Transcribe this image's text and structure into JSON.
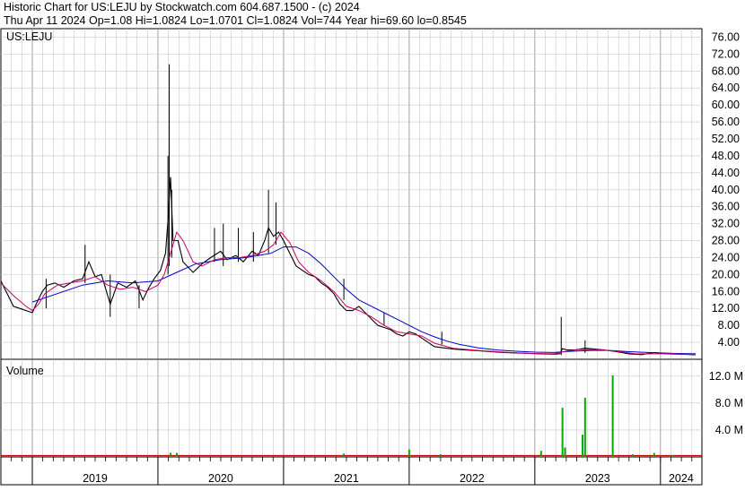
{
  "header": {
    "line1": "Historic Chart for US:LEJU by Stockwatch.com 604.687.1500 - (c) 2024",
    "line2": "Thu Apr 11 2024   Op=1.08   Hi=1.0824   Lo=1.0701   Cl=1.0824   Vol=744   Year hi=69.60   lo=0.8545"
  },
  "colors": {
    "price": "#000000",
    "ma_short": "#cc0066",
    "ma_long": "#0000cc",
    "volume": "#00aa00",
    "grid": "#c8c8c8"
  },
  "chart_data": [
    {
      "type": "line",
      "ticker_label": "US:LEJU",
      "ylim": [
        0,
        78
      ],
      "yticks": [
        "76.00",
        "72.00",
        "68.00",
        "64.00",
        "60.00",
        "56.00",
        "52.00",
        "48.00",
        "44.00",
        "40.00",
        "36.00",
        "32.00",
        "28.00",
        "24.00",
        "20.00",
        "16.00",
        "12.00",
        "8.00",
        "4.00"
      ],
      "ytick_values": [
        76,
        72,
        68,
        64,
        60,
        56,
        52,
        48,
        44,
        40,
        36,
        32,
        28,
        24,
        20,
        16,
        12,
        8,
        4
      ],
      "x_range": [
        2018.75,
        2024.33
      ],
      "grid": true,
      "price": [
        [
          2018.75,
          18.5
        ],
        [
          2018.8,
          15.5
        ],
        [
          2018.85,
          12.5
        ],
        [
          2018.9,
          12.0
        ],
        [
          2018.95,
          11.5
        ],
        [
          2019.0,
          11.0
        ],
        [
          2019.03,
          13.0
        ],
        [
          2019.08,
          16.0
        ],
        [
          2019.12,
          17.5
        ],
        [
          2019.18,
          18.0
        ],
        [
          2019.25,
          17.0
        ],
        [
          2019.33,
          18.5
        ],
        [
          2019.4,
          19.0
        ],
        [
          2019.45,
          23.0
        ],
        [
          2019.5,
          19.5
        ],
        [
          2019.55,
          20.0
        ],
        [
          2019.62,
          13.0
        ],
        [
          2019.68,
          18.0
        ],
        [
          2019.75,
          17.0
        ],
        [
          2019.82,
          18.5
        ],
        [
          2019.88,
          14.0
        ],
        [
          2019.92,
          16.5
        ],
        [
          2019.97,
          19.0
        ],
        [
          2020.02,
          21.0
        ],
        [
          2020.06,
          25.0
        ],
        [
          2020.08,
          33.0
        ],
        [
          2020.1,
          43.0
        ],
        [
          2020.12,
          28.0
        ],
        [
          2020.16,
          28.0
        ],
        [
          2020.2,
          23.0
        ],
        [
          2020.28,
          20.5
        ],
        [
          2020.35,
          22.5
        ],
        [
          2020.42,
          24.0
        ],
        [
          2020.5,
          25.5
        ],
        [
          2020.55,
          23.5
        ],
        [
          2020.62,
          24.5
        ],
        [
          2020.68,
          23.0
        ],
        [
          2020.75,
          25.5
        ],
        [
          2020.8,
          24.5
        ],
        [
          2020.85,
          28.0
        ],
        [
          2020.88,
          31.0
        ],
        [
          2020.92,
          29.0
        ],
        [
          2020.96,
          30.0
        ],
        [
          2021.0,
          28.0
        ],
        [
          2021.05,
          25.0
        ],
        [
          2021.1,
          22.0
        ],
        [
          2021.15,
          21.0
        ],
        [
          2021.2,
          20.0
        ],
        [
          2021.25,
          19.5
        ],
        [
          2021.3,
          18.0
        ],
        [
          2021.35,
          17.0
        ],
        [
          2021.4,
          15.5
        ],
        [
          2021.45,
          13.0
        ],
        [
          2021.5,
          11.5
        ],
        [
          2021.55,
          11.5
        ],
        [
          2021.6,
          12.5
        ],
        [
          2021.65,
          11.0
        ],
        [
          2021.7,
          9.5
        ],
        [
          2021.75,
          8.0
        ],
        [
          2021.8,
          7.5
        ],
        [
          2021.85,
          7.0
        ],
        [
          2021.9,
          6.0
        ],
        [
          2021.95,
          5.5
        ],
        [
          2022.0,
          6.5
        ],
        [
          2022.05,
          6.0
        ],
        [
          2022.1,
          5.0
        ],
        [
          2022.15,
          4.0
        ],
        [
          2022.2,
          3.0
        ],
        [
          2022.25,
          2.8
        ],
        [
          2022.3,
          2.6
        ],
        [
          2022.35,
          2.4
        ],
        [
          2022.45,
          2.2
        ],
        [
          2022.55,
          2.0
        ],
        [
          2022.65,
          1.8
        ],
        [
          2022.75,
          1.6
        ],
        [
          2022.85,
          1.5
        ],
        [
          2022.95,
          1.4
        ],
        [
          2023.05,
          1.3
        ],
        [
          2023.15,
          1.2
        ],
        [
          2023.2,
          1.3
        ],
        [
          2023.22,
          2.5
        ],
        [
          2023.26,
          2.2
        ],
        [
          2023.32,
          2.2
        ],
        [
          2023.4,
          2.6
        ],
        [
          2023.48,
          2.4
        ],
        [
          2023.55,
          2.2
        ],
        [
          2023.65,
          1.8
        ],
        [
          2023.75,
          1.3
        ],
        [
          2023.85,
          1.1
        ],
        [
          2023.95,
          1.6
        ],
        [
          2024.05,
          1.3
        ],
        [
          2024.15,
          1.2
        ],
        [
          2024.25,
          1.1
        ],
        [
          2024.28,
          1.0824
        ]
      ],
      "spikes": [
        [
          2019.11,
          19.0,
          12.0
        ],
        [
          2019.42,
          18.0,
          27.0
        ],
        [
          2019.62,
          10.0,
          20.0
        ],
        [
          2019.85,
          12.0,
          17.5
        ],
        [
          2020.08,
          20.0,
          48.0
        ],
        [
          2020.09,
          22.0,
          69.6
        ],
        [
          2020.11,
          24.0,
          40.0
        ],
        [
          2020.45,
          23.0,
          31.0
        ],
        [
          2020.52,
          22.0,
          32.0
        ],
        [
          2020.64,
          23.0,
          31.0
        ],
        [
          2020.76,
          23.0,
          30.0
        ],
        [
          2020.88,
          25.0,
          40.0
        ],
        [
          2020.94,
          27.0,
          37.0
        ],
        [
          2021.48,
          14.0,
          19.0
        ],
        [
          2021.8,
          8.0,
          11.0
        ],
        [
          2022.26,
          3.5,
          6.5
        ],
        [
          2023.21,
          1.0,
          10.0
        ],
        [
          2023.4,
          1.5,
          4.5
        ]
      ],
      "ma_short": [
        [
          2018.75,
          18.0
        ],
        [
          2018.85,
          15.0
        ],
        [
          2018.95,
          12.5
        ],
        [
          2019.0,
          11.5
        ],
        [
          2019.05,
          13.0
        ],
        [
          2019.1,
          15.5
        ],
        [
          2019.2,
          17.5
        ],
        [
          2019.3,
          18.0
        ],
        [
          2019.4,
          18.5
        ],
        [
          2019.5,
          19.5
        ],
        [
          2019.6,
          17.5
        ],
        [
          2019.7,
          16.5
        ],
        [
          2019.8,
          17.0
        ],
        [
          2019.9,
          16.0
        ],
        [
          2020.0,
          17.5
        ],
        [
          2020.05,
          20.0
        ],
        [
          2020.1,
          25.0
        ],
        [
          2020.15,
          30.0
        ],
        [
          2020.2,
          28.0
        ],
        [
          2020.28,
          23.0
        ],
        [
          2020.35,
          22.0
        ],
        [
          2020.45,
          23.5
        ],
        [
          2020.55,
          24.0
        ],
        [
          2020.65,
          24.0
        ],
        [
          2020.75,
          24.5
        ],
        [
          2020.85,
          25.5
        ],
        [
          2020.92,
          27.0
        ],
        [
          2020.98,
          30.0
        ],
        [
          2021.05,
          27.5
        ],
        [
          2021.12,
          23.0
        ],
        [
          2021.2,
          20.5
        ],
        [
          2021.3,
          18.5
        ],
        [
          2021.4,
          16.0
        ],
        [
          2021.5,
          12.5
        ],
        [
          2021.6,
          11.5
        ],
        [
          2021.7,
          10.0
        ],
        [
          2021.8,
          8.0
        ],
        [
          2021.9,
          6.5
        ],
        [
          2022.0,
          6.0
        ],
        [
          2022.1,
          5.5
        ],
        [
          2022.2,
          3.8
        ],
        [
          2022.35,
          2.6
        ],
        [
          2022.55,
          2.1
        ],
        [
          2022.75,
          1.7
        ],
        [
          2022.95,
          1.4
        ],
        [
          2023.15,
          1.3
        ],
        [
          2023.25,
          1.9
        ],
        [
          2023.35,
          2.3
        ],
        [
          2023.5,
          2.3
        ],
        [
          2023.65,
          1.9
        ],
        [
          2023.8,
          1.3
        ],
        [
          2023.95,
          1.3
        ],
        [
          2024.1,
          1.3
        ],
        [
          2024.28,
          1.1
        ]
      ],
      "ma_long": [
        [
          2019.0,
          13.5
        ],
        [
          2019.2,
          15.5
        ],
        [
          2019.4,
          17.5
        ],
        [
          2019.6,
          18.5
        ],
        [
          2019.8,
          18.0
        ],
        [
          2020.0,
          18.5
        ],
        [
          2020.15,
          20.5
        ],
        [
          2020.3,
          22.5
        ],
        [
          2020.5,
          23.5
        ],
        [
          2020.7,
          24.0
        ],
        [
          2020.9,
          25.0
        ],
        [
          2021.0,
          26.5
        ],
        [
          2021.1,
          26.5
        ],
        [
          2021.2,
          25.0
        ],
        [
          2021.3,
          22.5
        ],
        [
          2021.4,
          19.5
        ],
        [
          2021.5,
          16.5
        ],
        [
          2021.6,
          14.0
        ],
        [
          2021.7,
          12.5
        ],
        [
          2021.8,
          11.0
        ],
        [
          2021.9,
          9.5
        ],
        [
          2022.0,
          8.0
        ],
        [
          2022.1,
          6.5
        ],
        [
          2022.2,
          5.3
        ],
        [
          2022.3,
          4.3
        ],
        [
          2022.4,
          3.5
        ],
        [
          2022.55,
          2.7
        ],
        [
          2022.7,
          2.2
        ],
        [
          2022.85,
          1.9
        ],
        [
          2023.0,
          1.7
        ],
        [
          2023.15,
          1.6
        ],
        [
          2023.3,
          1.9
        ],
        [
          2023.45,
          2.1
        ],
        [
          2023.6,
          2.1
        ],
        [
          2023.75,
          1.8
        ],
        [
          2023.9,
          1.6
        ],
        [
          2024.1,
          1.4
        ],
        [
          2024.28,
          1.3
        ]
      ]
    },
    {
      "type": "bar",
      "label": "Volume",
      "ylim": [
        0,
        14.5
      ],
      "unit": "M",
      "yticks": [
        "12.0 M",
        "8.0 M",
        "4.0 M"
      ],
      "ytick_values": [
        12,
        8,
        4
      ],
      "x_range": [
        2018.75,
        2024.33
      ],
      "bars": [
        [
          2020.1,
          0.6
        ],
        [
          2020.15,
          0.6
        ],
        [
          2021.48,
          0.5
        ],
        [
          2022.0,
          1.1
        ],
        [
          2022.25,
          0.4
        ],
        [
          2023.05,
          0.9
        ],
        [
          2023.22,
          7.3
        ],
        [
          2023.24,
          1.4
        ],
        [
          2023.38,
          3.3
        ],
        [
          2023.4,
          8.8
        ],
        [
          2023.62,
          12.1
        ],
        [
          2023.78,
          0.4
        ],
        [
          2023.95,
          0.6
        ],
        [
          2024.1,
          0.3
        ]
      ]
    }
  ],
  "x_axis": {
    "years": [
      "2019",
      "2020",
      "2021",
      "2022",
      "2023",
      "2024"
    ],
    "year_centers": [
      2019.5,
      2020.5,
      2021.5,
      2022.5,
      2023.5,
      2024.165
    ]
  }
}
